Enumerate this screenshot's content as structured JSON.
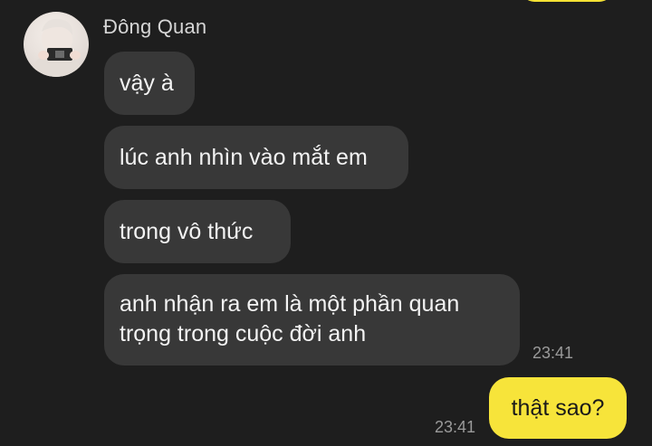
{
  "contact": {
    "name": "Đông Quan"
  },
  "messages_in": [
    "vậy à",
    "lúc anh nhìn vào mắt em",
    "trong vô thức",
    "anh nhận ra em là một phần quan",
    "trọng trong cuộc đời anh"
  ],
  "in_time": "23:41",
  "message_out": "thật sao?",
  "out_time": "23:41",
  "colors": {
    "background": "#1e1e1e",
    "incoming_bubble": "#383838",
    "outgoing_bubble": "#f7e43a",
    "timestamp": "#9a9a9a"
  }
}
